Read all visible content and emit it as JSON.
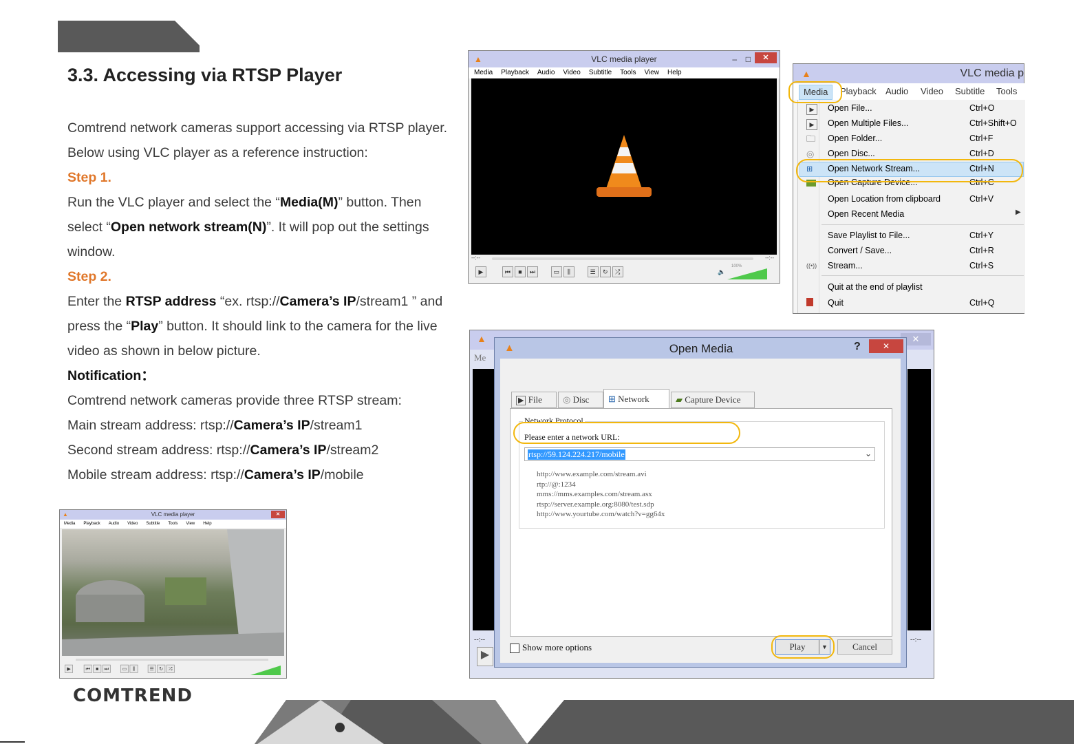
{
  "section": {
    "title": "3.3. Accessing via RTSP Player",
    "intro": "Comtrend network cameras support accessing via RTSP player. Below using VLC player as a reference instruction:",
    "step1_label": "Step 1.",
    "step1_pre": "Run the VLC player and select the “",
    "step1_media": "Media(M)",
    "step1_mid": "” button. Then select “",
    "step1_open": "Open network stream(N)",
    "step1_post": "”. It will pop out the settings window.",
    "step2_label": "Step 2.",
    "step2_pre": "Enter the ",
    "step2_rtsp": "RTSP address",
    "step2_ex": " “ex. rtsp://",
    "step2_cam": "Camera’s IP",
    "step2_mid": "/stream1 ” and press the  “",
    "step2_play": "Play",
    "step2_post": "” button. It should link to the camera for the live video as shown in below picture.",
    "notification": "Notification：",
    "notif_text": "Comtrend network cameras provide three RTSP stream:",
    "streams": [
      {
        "pre": "Main stream address: rtsp://",
        "cam": "Camera’s IP",
        "post": "/stream1"
      },
      {
        "pre": "Second stream address: rtsp://",
        "cam": "Camera’s IP",
        "post": "/stream2"
      },
      {
        "pre": "Mobile stream address: rtsp://",
        "cam": "Camera’s IP",
        "post": "/mobile"
      }
    ]
  },
  "vlc": {
    "title": "VLC media player",
    "menus": [
      "Media",
      "Playback",
      "Audio",
      "Video",
      "Subtitle",
      "Tools",
      "View",
      "Help"
    ],
    "time_left": "--:--",
    "time_right": "--:--",
    "volume": "100%"
  },
  "menu": {
    "title": "VLC media p",
    "bar": [
      "Media",
      "Playback",
      "Audio",
      "Video",
      "Subtitle",
      "Tools"
    ],
    "items": [
      {
        "label": "Open File...",
        "shortcut": "Ctrl+O",
        "icon": "play-file-icon"
      },
      {
        "label": "Open Multiple Files...",
        "shortcut": "Ctrl+Shift+O",
        "icon": "play-file-icon"
      },
      {
        "label": "Open Folder...",
        "shortcut": "Ctrl+F",
        "icon": "folder-icon"
      },
      {
        "label": "Open Disc...",
        "shortcut": "Ctrl+D",
        "icon": "disc-icon"
      },
      {
        "label": "Open Network Stream...",
        "shortcut": "Ctrl+N",
        "icon": "network-icon"
      },
      {
        "label": "Open Capture Device...",
        "shortcut": "Ctrl+C",
        "icon": "capture-icon"
      },
      {
        "label": "Open Location from clipboard",
        "shortcut": "Ctrl+V",
        "icon": ""
      },
      {
        "label": "Open Recent Media",
        "shortcut": "",
        "icon": ""
      },
      {
        "label": "Save Playlist to File...",
        "shortcut": "Ctrl+Y",
        "icon": ""
      },
      {
        "label": "Convert / Save...",
        "shortcut": "Ctrl+R",
        "icon": ""
      },
      {
        "label": "Stream...",
        "shortcut": "Ctrl+S",
        "icon": "stream-icon"
      },
      {
        "label": "Quit at the end of playlist",
        "shortcut": "",
        "icon": ""
      },
      {
        "label": "Quit",
        "shortcut": "Ctrl+Q",
        "icon": "quit-icon"
      }
    ]
  },
  "open_media": {
    "title": "Open Media",
    "help": "?",
    "close": "✕",
    "tabs": [
      "File",
      "Disc",
      "Network",
      "Capture Device"
    ],
    "group_label": "Network Protocol",
    "url_label": "Please enter a network URL:",
    "url_value": "rtsp://59.124.224.217/mobile",
    "examples": [
      "http://www.example.com/stream.avi",
      "rtp://@:1234",
      "mms://mms.examples.com/stream.asx",
      "rtsp://server.example.org:8080/test.sdp",
      "http://www.yourtube.com/watch?v=gg64x"
    ],
    "show_more": "Show more options",
    "play": "Play",
    "cancel": "Cancel",
    "bg_menu": "Me",
    "bg_time": "--:--"
  },
  "footer": {
    "logo": "COMTREND"
  }
}
